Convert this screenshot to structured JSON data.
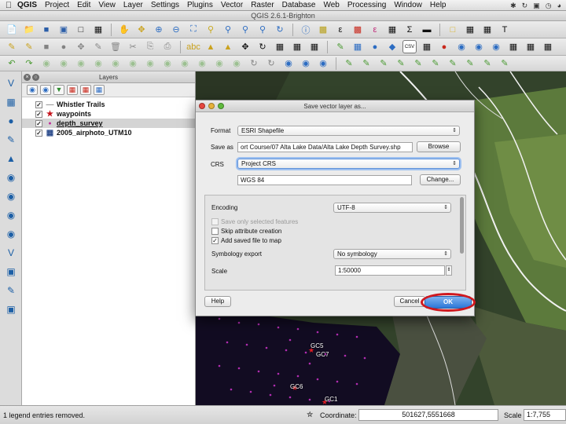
{
  "menubar": {
    "app_name": "QGIS",
    "items": [
      "Project",
      "Edit",
      "View",
      "Layer",
      "Settings",
      "Plugins",
      "Vector",
      "Raster",
      "Database",
      "Web",
      "Processing",
      "Window",
      "Help"
    ]
  },
  "window": {
    "title": "QGIS 2.6.1-Brighton"
  },
  "layers_panel": {
    "title": "Layers",
    "layers": [
      {
        "name": "Whistler Trails",
        "checked": true,
        "icon": "line-layer-icon",
        "selected": false
      },
      {
        "name": "waypoints",
        "checked": true,
        "icon": "star-point-icon",
        "selected": false
      },
      {
        "name": "depth_survey",
        "checked": true,
        "icon": "point-layer-icon",
        "selected": true
      },
      {
        "name": "2005_airphoto_UTM10",
        "checked": true,
        "icon": "raster-layer-icon",
        "selected": false
      }
    ]
  },
  "dialog": {
    "title": "Save vector layer as...",
    "format_label": "Format",
    "format_value": "ESRI Shapefile",
    "save_as_label": "Save as",
    "save_as_value": "ort Course/07 Alta Lake Data/Alta Lake Depth Survey.shp",
    "browse_label": "Browse",
    "crs_label": "CRS",
    "crs_value": "Project CRS",
    "crs_name": "WGS 84",
    "change_label": "Change...",
    "encoding_label": "Encoding",
    "encoding_value": "UTF-8",
    "save_selected_label": "Save only selected features",
    "skip_attr_label": "Skip attribute creation",
    "add_to_map_label": "Add saved file to map",
    "symbology_label": "Symbology export",
    "symbology_value": "No symbology",
    "scale_label": "Scale",
    "scale_value": "1:50000",
    "help_label": "Help",
    "cancel_label": "Cancel",
    "ok_label": "OK",
    "save_selected_checked": false,
    "skip_attr_checked": false,
    "add_to_map_checked": true
  },
  "map_labels": [
    "GC5",
    "GC7",
    "GC6",
    "GC1"
  ],
  "statusbar": {
    "message": "1 legend entries removed.",
    "coordinate_label": "Coordinate:",
    "coordinate_value": "501627,5551668",
    "scale_label": "Scale",
    "scale_value": "1:7,755"
  },
  "colors": {
    "ok_button": "#2d78d8",
    "highlight_ring": "#d0191f",
    "map_water": "#0e0a1e",
    "map_forest": "#33432b"
  }
}
